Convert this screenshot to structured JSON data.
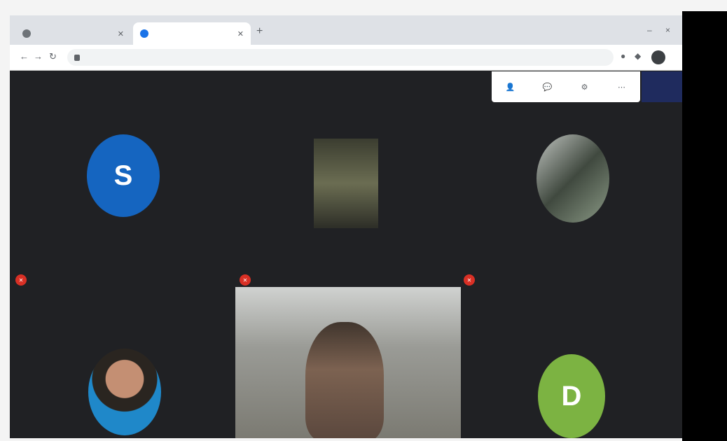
{
  "browser": {
    "tabs": [
      {
        "title": "",
        "active": false
      },
      {
        "title": "",
        "active": true
      }
    ],
    "new_tab_icon": "+",
    "url": "",
    "window_controls": [
      "–",
      "×"
    ]
  },
  "meeting": {
    "participants": [
      {
        "initial": "S",
        "name": "",
        "muted": true,
        "avatar_color": "#1565c0",
        "type": "letter"
      },
      {
        "initial": "",
        "name": "",
        "muted": true,
        "type": "photo"
      },
      {
        "initial": "",
        "name": "",
        "muted": true,
        "type": "photo"
      },
      {
        "initial": "",
        "name": "",
        "muted": true,
        "type": "photo"
      },
      {
        "initial": "",
        "name": "",
        "muted": false,
        "type": "video"
      },
      {
        "initial": "D",
        "name": "",
        "muted": false,
        "avatar_color": "#7cb342",
        "type": "letter"
      }
    ],
    "controls": [
      "",
      "",
      "",
      ""
    ]
  }
}
